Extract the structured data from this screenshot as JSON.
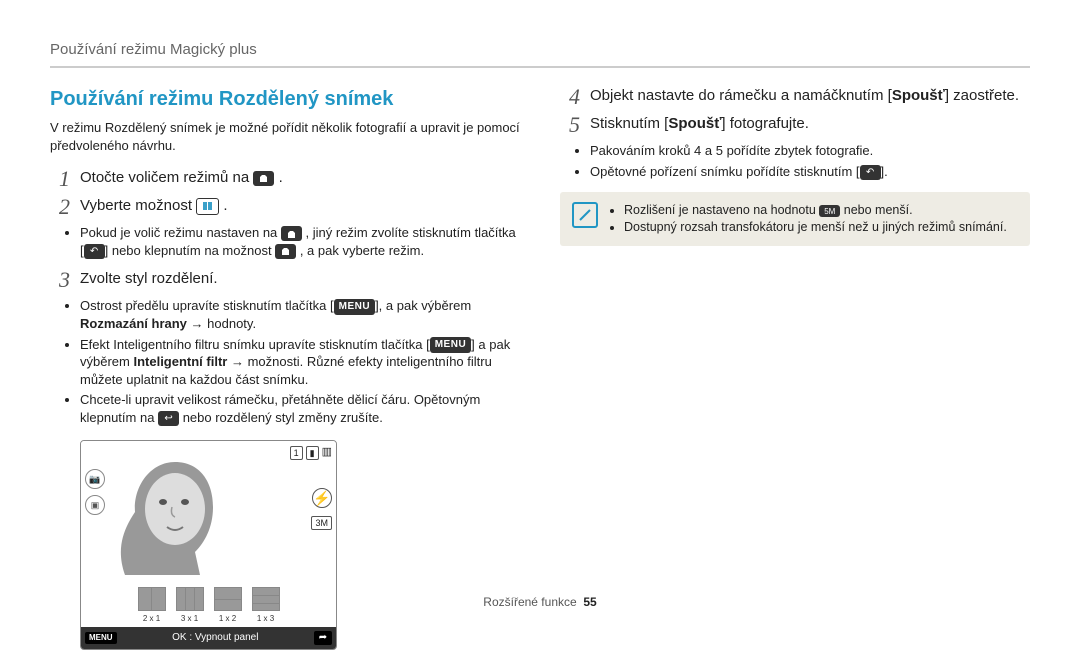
{
  "breadcrumb": "Používání režimu Magický plus",
  "section_title": "Používání režimu Rozdělený snímek",
  "intro": "V režimu Rozdělený snímek je možné pořídit několik fotografií a upravit je pomocí předvoleného návrhu.",
  "left": {
    "step1": "Otočte voličem režimů na",
    "step2": "Vyberte možnost",
    "step2_note_a": "Pokud je volič režimu nastaven na",
    "step2_note_b": ", jiný režim zvolíte stisknutím tlačítka [",
    "step2_note_c": "] nebo klepnutím na možnost",
    "step2_note_d": ", a pak vyberte režim.",
    "step3": "Zvolte styl rozdělení.",
    "s3_a1": "Ostrost předělu upravíte stisknutím tlačítka [",
    "s3_a2": "], a pak výběrem",
    "s3_a3_bold": "Rozmazání hrany",
    "s3_a4": " → hodnoty.",
    "s3_b1": "Efekt Inteligentního filtru snímku upravíte stisknutím tlačítka [",
    "s3_b2": "] a pak výběrem ",
    "s3_b3_bold": "Inteligentní filtr",
    "s3_b4": " → možnosti. Různé efekty inteligentního filtru můžete uplatnit na každou část snímku.",
    "s3_c": "Chcete-li upravit velikost rámečku, přetáhněte dělicí čáru. Opětovným klepnutím na",
    "s3_c2": "nebo rozdělený styl změny zrušíte."
  },
  "right": {
    "step4_a": "Objekt nastavte do rámečku a namáčknutím [",
    "step4_bold": "Spoušť",
    "step4_b": "] zaostřete.",
    "step5_a": "Stisknutím [",
    "step5_bold": "Spoušť",
    "step5_b": "] fotografujte.",
    "s5_n1": "Pakováním kroků 4 a 5 pořídíte zbytek fotografie.",
    "s5_n2_a": "Opětovné pořízení snímku pořídíte stisknutím [",
    "s5_n2_b": "].",
    "callout1_a": "Rozlišení je nastaveno na hodnotu",
    "callout1_b": "nebo menší.",
    "callout2": "Dostupný rozsah transfokátoru je menší než u jiných režimů snímání."
  },
  "lcd": {
    "menu": "MENU",
    "ok_text": "OK : Vypnout panel",
    "layouts": [
      "2 x 1",
      "3 x 1",
      "1 x 2",
      "1 x 3"
    ],
    "count": "1"
  },
  "icons": {
    "menu_label": "MENU",
    "resolution_label": "5M"
  },
  "footer_label": "Rozšířené funkce",
  "page_number": "55"
}
